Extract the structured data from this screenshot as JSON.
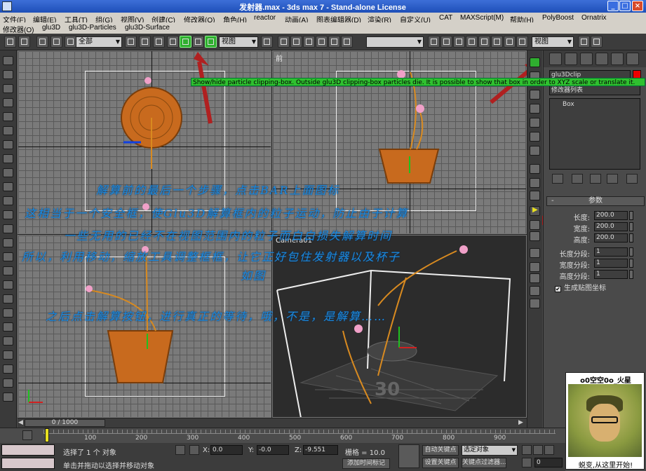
{
  "window": {
    "title": "发射器.max - 3ds max 7  - Stand-alone License"
  },
  "menu_main": [
    "文件(F)",
    "编辑(E)",
    "工具(T)",
    "组(G)",
    "视图(V)",
    "创建(C)",
    "修改器(O)",
    "角色(H)",
    "reactor",
    "动画(A)",
    "图表编辑器(D)",
    "渲染(R)",
    "自定义(U)",
    "CAT",
    "MAXScript(M)",
    "帮助(H)",
    "PolyBoost",
    "Ornatrix"
  ],
  "menu_plugins": [
    "修改器(O)",
    "glu3D",
    "glu3D-Particles",
    "glu3D-Surface"
  ],
  "toolbar": {
    "selection_filter": "全部",
    "ref_coord": "视图",
    "named_selection": "",
    "viewport_dropdown": "视图"
  },
  "tooltip": "Show/hide particle clipping-box. Outside glu3D clipping-box particles die. It is possible to show that box in order to XYZ scale or translate it.",
  "viewports": {
    "top_right_label": "前",
    "persp_label": "Camera01"
  },
  "notes": [
    "解算前的最后一个步骤，点击BAR上面图标",
    "这相当于一个安全框，使Glu3D解算框内的粒子运动，防止由于计算",
    "一些无用的已经不在视图范围内的粒子而白白损失解算时间",
    "所以，利用移动，缩放工具调整框框，让它正好包住发射器以及杯子",
    "如图",
    "之后点击解算按钮，进行真正的等待，哦，不是，是解算……"
  ],
  "command_panel": {
    "object_name": "glu3Dclip",
    "modifier_list": "修改器列表",
    "stack_item": "Box",
    "section_title": "参数",
    "params": [
      {
        "label": "长度:",
        "value": "200.0"
      },
      {
        "label": "宽度:",
        "value": "200.0"
      },
      {
        "label": "高度:",
        "value": "200.0"
      },
      {
        "label": "长度分段:",
        "value": "1"
      },
      {
        "label": "宽度分段:",
        "value": "1"
      },
      {
        "label": "高度分段:",
        "value": "1"
      }
    ],
    "checkbox_label": "生成贴图坐标",
    "checkbox_checked": true
  },
  "time_slider": {
    "frame": "0 / 1000"
  },
  "timeline_ticks": [
    "100",
    "200",
    "300",
    "400",
    "500",
    "600",
    "700",
    "800",
    "900"
  ],
  "status": {
    "selected": "选择了 1 个 对象",
    "prompt": "单击并拖动以选择并移动对象",
    "x_label": "X:",
    "x_value": "0.0",
    "y_label": "Y:",
    "y_value": "-0.0",
    "z_label": "Z:",
    "z_value": "-9.551",
    "grid": "栅格 = 10.0",
    "add_time_tag": "添加时间标记",
    "auto_key": "自动关键点",
    "auto_key_dd": "选定对象",
    "set_key": "设置关键点",
    "key_filter": "关键点过滤器...",
    "frame_field": "0"
  },
  "avatar": {
    "name": "o0空空0o_火星",
    "caption": "蜕变,从这里开始!"
  },
  "colors": {
    "note_blue": "#1a8ae0",
    "tooltip_green": "#2fc02f",
    "arrow_red": "#b02020",
    "object_color": "#e00000"
  }
}
